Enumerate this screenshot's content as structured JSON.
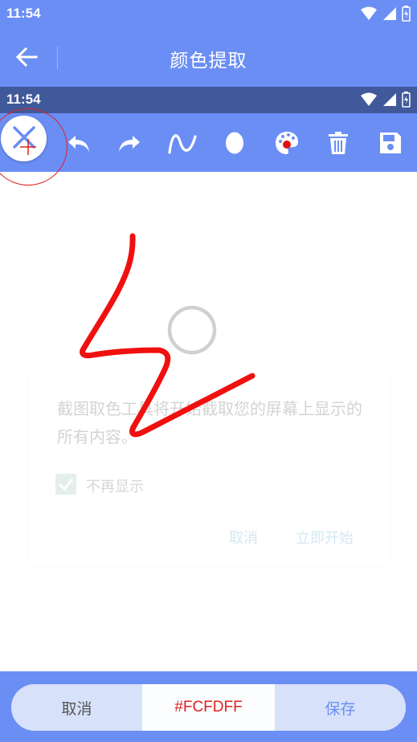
{
  "status_bar": {
    "time": "11:54"
  },
  "app_bar": {
    "title": "颜色提取"
  },
  "inner_status_bar": {
    "time": "11:54"
  },
  "toolbar": {
    "tools": [
      "close-icon",
      "undo-icon",
      "redo-icon",
      "freehand-curve-icon",
      "ellipse-icon",
      "palette-icon",
      "delete-icon",
      "save-icon"
    ]
  },
  "dialog": {
    "message": "截图取色工具将开始截取您的屏幕上显示的所有内容。",
    "checkbox_label": "不再显示",
    "cancel_label": "取消",
    "start_label": "立即开始"
  },
  "bottom_bar": {
    "cancel_label": "取消",
    "color_value": "#FCFDFF",
    "save_label": "保存"
  },
  "colors": {
    "accent": "#6b8ef5",
    "inner_status": "#40599b",
    "stroke": "#f01010"
  }
}
